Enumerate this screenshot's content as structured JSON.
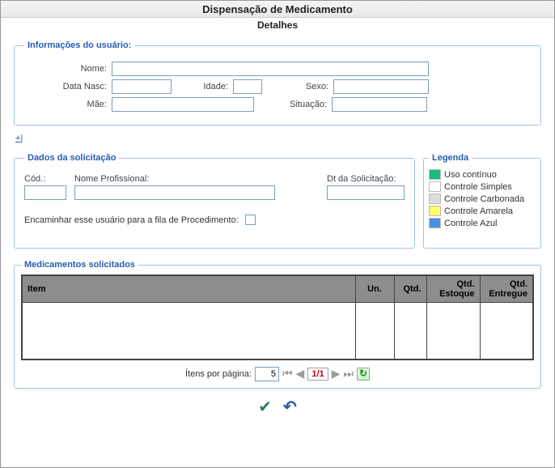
{
  "window": {
    "title": "Dispensação de Medicamento",
    "subtitle": "Detalhes"
  },
  "user_info": {
    "legend": "Informações do usuário:",
    "nome_label": "Nome:",
    "nome": "",
    "data_nasc_label": "Data Nasc:",
    "data_nasc": "",
    "idade_label": "Idade:",
    "idade": "",
    "sexo_label": "Sexo:",
    "sexo": "",
    "mae_label": "Mãe:",
    "mae": "",
    "situacao_label": "Situação:",
    "situacao": ""
  },
  "expand": {
    "label": "+|"
  },
  "request": {
    "legend": "Dados da solicitação",
    "cod_label": "Cód.:",
    "cod": "",
    "prof_label": "Nome Profissional:",
    "prof": "",
    "dt_label": "Dt da Solicitação:",
    "dt": "",
    "forward_label": "Encaminhar esse usuário para a fila de Procedimento:"
  },
  "legend_box": {
    "legend": "Legenda",
    "items": [
      {
        "label": "Uso contínuo",
        "color": "#1abc7d"
      },
      {
        "label": "Controle Simples",
        "color": "#ffffff"
      },
      {
        "label": "Controle Carbonada",
        "color": "#dcdcdc"
      },
      {
        "label": "Controle Amarela",
        "color": "#ffff66"
      },
      {
        "label": "Controle Azul",
        "color": "#4a90e2"
      }
    ]
  },
  "meds": {
    "legend": "Medicamentos solicitados",
    "columns": {
      "item": "Item",
      "un": "Un.",
      "qtd": "Qtd.",
      "estoque": "Qtd. Estoque",
      "entregue": "Qtd. Entregue"
    },
    "rows": []
  },
  "pager": {
    "label": "Ítens por página:",
    "per_page": "5",
    "current": "1/1"
  }
}
